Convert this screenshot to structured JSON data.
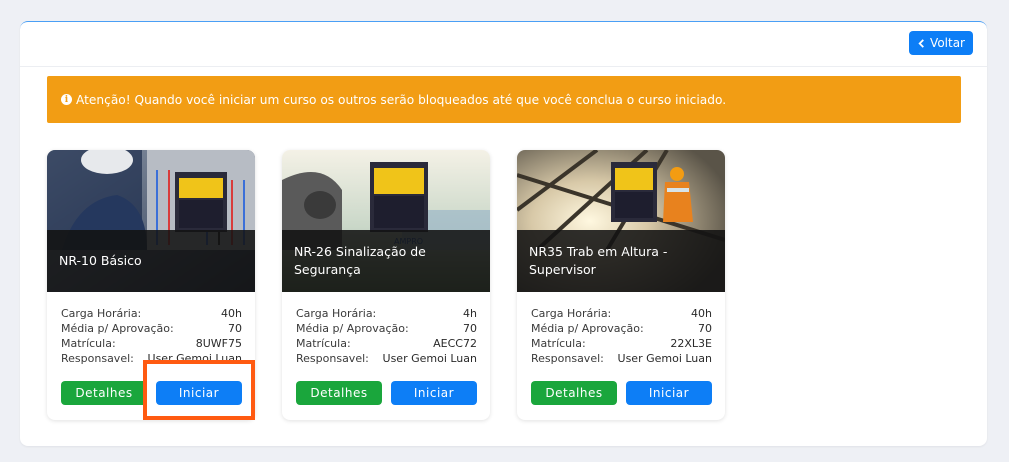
{
  "header": {
    "back_label": "Voltar"
  },
  "alert": {
    "message": "Atenção! Quando você iniciar um curso os outros serão bloqueados até que você conclua o curso iniciado."
  },
  "labels": {
    "carga": "Carga Horária:",
    "media": "Média p/ Aprovação:",
    "matricula": "Matrícula:",
    "responsavel": "Responsavel:",
    "details_button": "Detalhes",
    "start_button": "Iniciar"
  },
  "courses": [
    {
      "title": "NR-10 Básico",
      "carga": "40h",
      "media": "70",
      "matricula": "8UWF75",
      "responsavel": "User Gemoi Luan"
    },
    {
      "title": "NR-26 Sinalização de Segurança",
      "carga": "4h",
      "media": "70",
      "matricula": "AECC72",
      "responsavel": "User Gemoi Luan"
    },
    {
      "title": "NR35 Trab em Altura - Supervisor",
      "carga": "40h",
      "media": "70",
      "matricula": "22XL3E",
      "responsavel": "User Gemoi Luan"
    }
  ],
  "colors": {
    "primary": "#0d7ef6",
    "success": "#1aa63c",
    "warning": "#f29d14",
    "highlight": "#ff5a11"
  }
}
